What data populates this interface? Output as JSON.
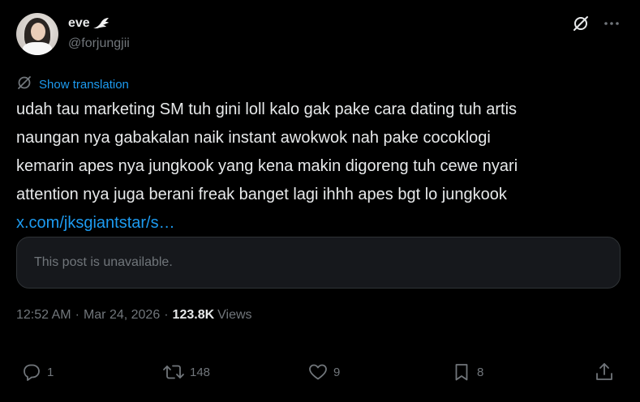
{
  "author": {
    "display_name": "eve",
    "badge_icon": "angel-wing-icon",
    "handle": "@forjungjii"
  },
  "header_actions": {
    "grok_icon": "grok-icon",
    "more_icon": "more-horizontal-icon"
  },
  "translation": {
    "label": "Show translation",
    "icon": "translate-icon"
  },
  "post": {
    "lines": [
      "udah tau marketing SM tuh gini loll kalo gak pake cara dating tuh artis",
      "naungan nya gabakalan naik instant awokwok nah pake cocoklogi",
      "kemarin apes nya jungkook yang kena makin digoreng tuh cewe nyari",
      "attention nya juga berani freak banget lagi ihhh apes bgt lo jungkook"
    ],
    "link": "x.com/jksgiantstar/s…"
  },
  "quote": {
    "text": "This post is unavailable."
  },
  "meta": {
    "time": "12:52 AM",
    "separator": "·",
    "date": "Mar 24, 2026",
    "views_count": "123.8K",
    "views_label": "Views"
  },
  "actions": {
    "replies": "1",
    "reposts": "148",
    "likes": "9",
    "bookmarks": "8"
  },
  "colors": {
    "background": "#000000",
    "text_primary": "#e7e9ea",
    "text_secondary": "#71767b",
    "accent": "#1d9bf0",
    "card_background": "#16181c",
    "border": "#2f3336"
  }
}
